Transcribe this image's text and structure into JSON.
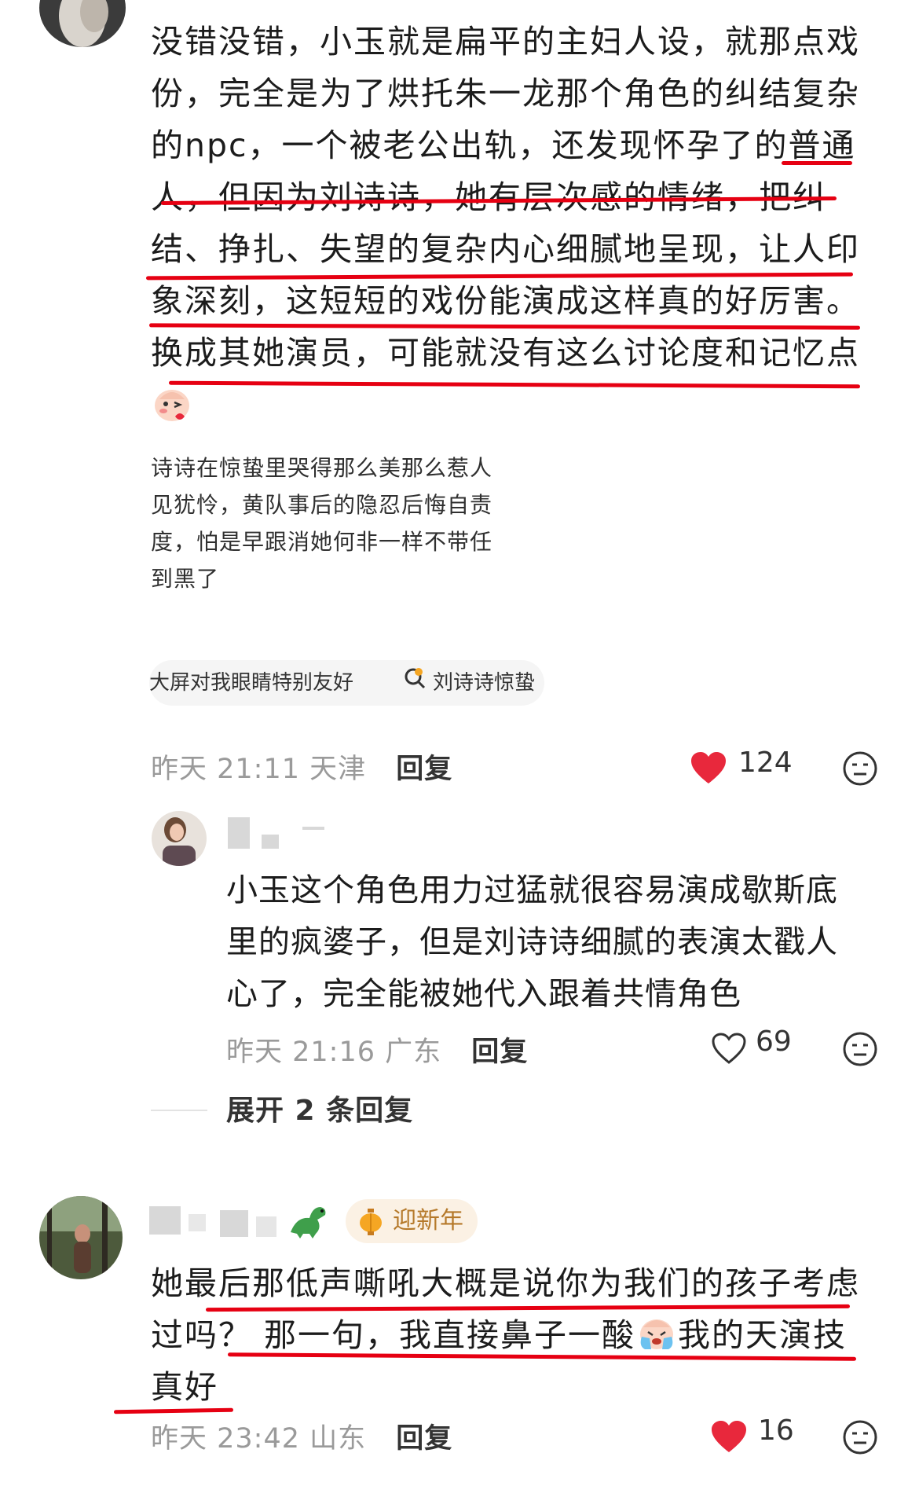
{
  "comment1": {
    "lines": [
      "没错没错，小玉就是扁平的主妇人设，就那点戏",
      "份，完全是为了烘托朱一龙那个角色的纠结复杂",
      "的npc，一个被老公出轨，还发现怀孕了的普通",
      "人，但因为刘诗诗，她有层次感的情绪，把纠",
      "结、挣扎、失望的复杂内心细腻地呈现，让人印",
      "象深刻，这短短的戏份能演成这样真的好厉害。",
      "换成其她演员，可能就没有这么讨论度和记忆点"
    ],
    "quote_lines": [
      "诗诗在惊蛰里哭得那么美那么惹人",
      "见犹怜，黄队事后的隐忍后悔自责",
      "度，怕是早跟消她何非一样不带任",
      "到黑了"
    ],
    "chips": [
      "大屏对我眼睛特别友好",
      "刘诗诗惊蛰"
    ],
    "meta": "昨天 21:11 天津",
    "reply_label": "回复",
    "likes": "124"
  },
  "reply1": {
    "lines": [
      "小玉这个角色用力过猛就很容易演成歇斯底",
      "里的疯婆子，但是刘诗诗细腻的表演太戳人",
      "心了，完全能被她代入跟着共情角色"
    ],
    "meta": "昨天 21:16 广东",
    "reply_label": "回复",
    "likes": "69"
  },
  "expand_label": "展开 2 条回复",
  "comment2": {
    "badge": "迎新年",
    "lines": [
      "她最后那低声嘶吼大概是说你为我们的孩子考虑",
      "过吗？ 那一句，我直接鼻子一酸",
      "真好"
    ],
    "line2_tail": "我的天演技",
    "meta": "昨天 23:42 山东",
    "reply_label": "回复",
    "likes": "16"
  },
  "colors": {
    "accent_red": "#e60012",
    "heart_red": "#e8283c",
    "meta_gray": "#9a9a9a"
  }
}
